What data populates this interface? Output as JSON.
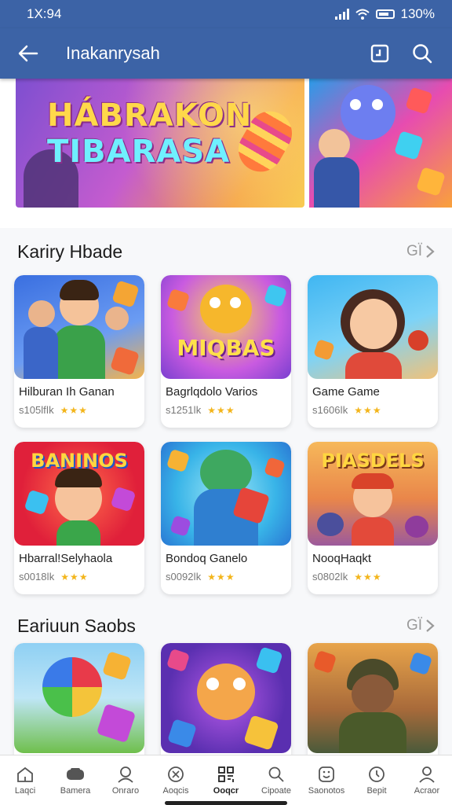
{
  "status": {
    "time": "1X:94",
    "battery": "130%"
  },
  "appbar": {
    "title": "Inakanrysah"
  },
  "banner": {
    "line1": "HÁBRAKON",
    "line2": "TIBARASA"
  },
  "sections": [
    {
      "title": "Kariry Hbade",
      "more": "GÏ",
      "items": [
        {
          "name": "Hilburan Ih Ganan",
          "meta": "s105lfǀk"
        },
        {
          "name": "Bagrlqdolo Varios",
          "meta": "s1251ǀk"
        },
        {
          "name": "Game Game",
          "meta": "s1606ǀk"
        },
        {
          "name": "Hbarral!Selyhaola",
          "meta": "s0018ǀk"
        },
        {
          "name": "Bondoq Ganelo",
          "meta": "s0092ǀk"
        },
        {
          "name": "NooqHaqkt",
          "meta": "s0802ǀk"
        }
      ]
    },
    {
      "title": "Eariuun Saobs",
      "more": "GÏ"
    }
  ],
  "thumb_texts": {
    "t2": "MIQBAS",
    "t4": "BANINOS",
    "t6": "PIASDELS"
  },
  "nav": [
    {
      "label": "Laqci",
      "icon": "home-icon"
    },
    {
      "label": "Bamera",
      "icon": "controller-icon"
    },
    {
      "label": "Onraro",
      "icon": "person-icon"
    },
    {
      "label": "Aoqcis",
      "icon": "dice-icon"
    },
    {
      "label": "Ooqcr",
      "icon": "qr-icon"
    },
    {
      "label": "Cipoate",
      "icon": "search-icon"
    },
    {
      "label": "Saonotos",
      "icon": "smile-icon"
    },
    {
      "label": "Bepit",
      "icon": "clock-icon"
    },
    {
      "label": "Acraor",
      "icon": "profile-icon"
    }
  ],
  "colors": {
    "appbar": "#3c63a6",
    "star": "#f3b51b"
  }
}
